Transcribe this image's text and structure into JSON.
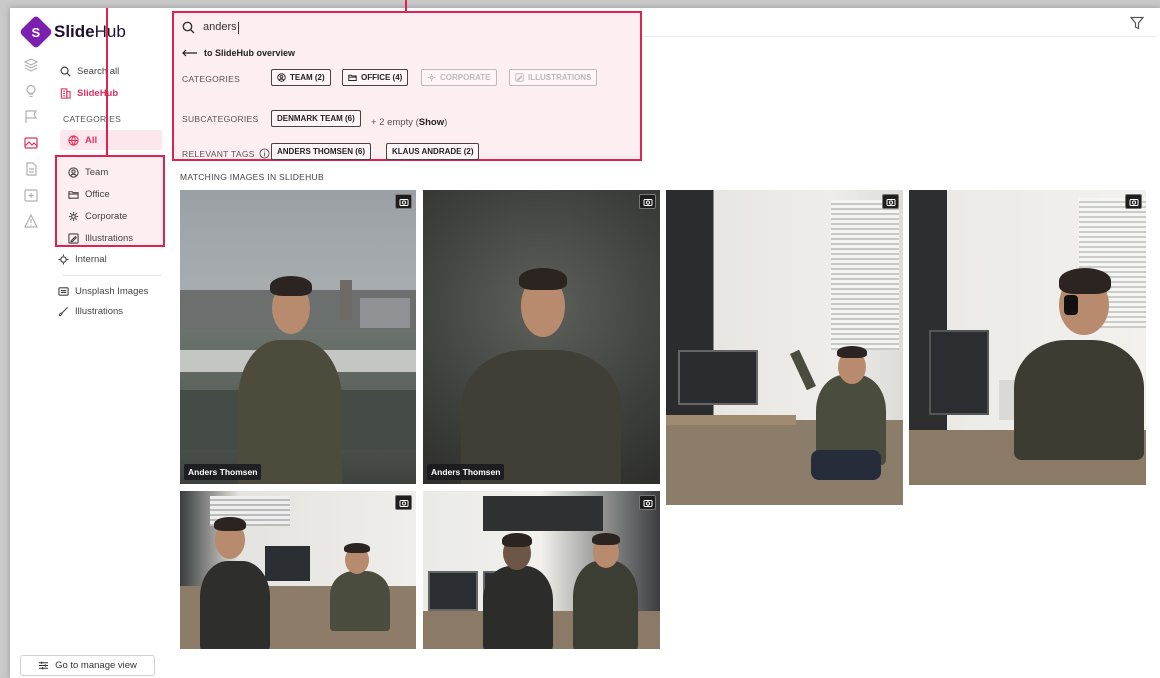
{
  "app": {
    "logo_letter": "S",
    "logo_name_a": "Slide",
    "logo_name_b": "Hub"
  },
  "rail": {
    "icons": [
      "layers-icon",
      "lightbulb-icon",
      "flag-icon",
      "image-icon",
      "document-icon",
      "add-folder-icon",
      "warning-icon"
    ],
    "active": "image-icon"
  },
  "sidebar": {
    "search_label": "Search all",
    "slidehub_label": "SlideHub",
    "categories_heading": "CATEGORIES",
    "all_label": "All",
    "items": [
      {
        "label": "Team",
        "icon": "user-circle-icon"
      },
      {
        "label": "Office",
        "icon": "folder-icon"
      },
      {
        "label": "Corporate",
        "icon": "gear-icon"
      },
      {
        "label": "Illustrations",
        "icon": "edit-icon"
      },
      {
        "label": "Internal",
        "icon": "cog-icon"
      }
    ],
    "unsplash_label": "Unsplash Images",
    "illustrations_label": "Illustrations",
    "manage_button": "Go to manage view"
  },
  "search": {
    "value": "anders",
    "back_label": "to SlideHub overview",
    "categories_label": "CATEGORIES",
    "categories": [
      {
        "label": "TEAM (2)",
        "icon": "user-circle-icon",
        "enabled": true
      },
      {
        "label": "OFFICE (4)",
        "icon": "folder-icon",
        "enabled": true
      },
      {
        "label": "CORPORATE",
        "icon": "gear-icon",
        "enabled": false
      },
      {
        "label": "ILLUSTRATIONS",
        "icon": "edit-icon",
        "enabled": false
      }
    ],
    "subcategories_label": "SUBCATEGORIES",
    "subcategory_chip": "DENMARK TEAM (6)",
    "empty_prefix": "+ 2 empty (",
    "empty_show": "Show",
    "empty_suffix": ")",
    "relevant_tags_label": "RELEVANT TAGS",
    "tags": [
      "ANDERS THOMSEN (6)",
      "KLAUS ANDRADE (2)"
    ]
  },
  "results": {
    "section_title": "MATCHING IMAGES IN SLIDEHUB",
    "images": [
      {
        "caption": "Anders Thomsen",
        "scene": "portrait-outdoor-city"
      },
      {
        "caption": "Anders Thomsen",
        "scene": "portrait-studio-grey"
      },
      {
        "caption": "",
        "scene": "office-chair-waving"
      },
      {
        "caption": "",
        "scene": "office-headphones-desk"
      },
      {
        "caption": "",
        "scene": "office-two-people-talking"
      },
      {
        "caption": "",
        "scene": "office-two-people-desk"
      }
    ]
  },
  "colors": {
    "accent": "#e0335f",
    "highlight_border": "#e0234e",
    "highlight_fill": "#fdeef2",
    "brand_purple": "#7a1fb0"
  }
}
